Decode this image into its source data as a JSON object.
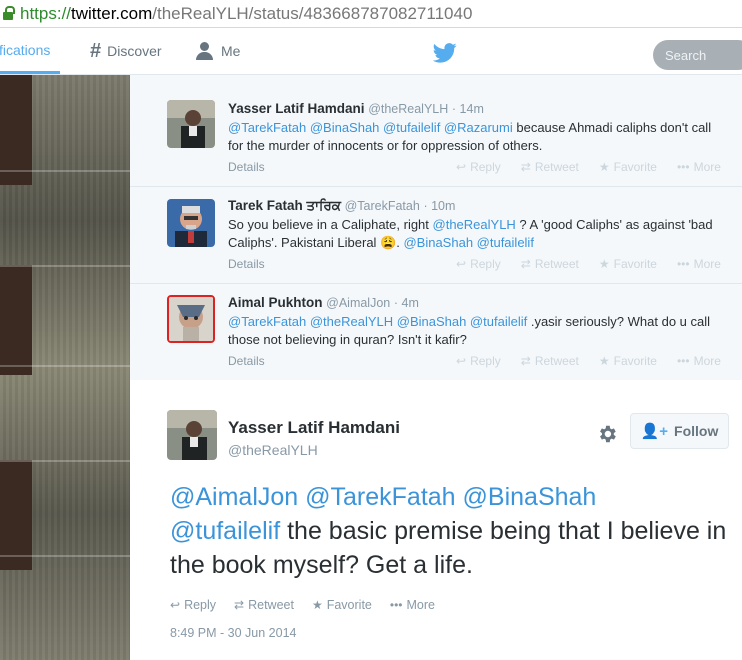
{
  "browser": {
    "url_scheme": "https://",
    "url_host": "twitter.com",
    "url_path": "/theRealYLH/status/483668787082711040"
  },
  "nav": {
    "notifications": "tifications",
    "discover": "Discover",
    "me": "Me",
    "search_placeholder": "Search"
  },
  "replies": [
    {
      "name": "Yasser Latif Hamdani",
      "handle": "@theRealYLH",
      "time": "· 14m",
      "mentions": "@TarekFatah @BinaShah @tufailelif @Razarumi",
      "text": " because Ahmadi caliphs don't call for the murder of innocents or for oppression of others."
    },
    {
      "name": "Tarek Fatah ਤਾਰਿਕ",
      "handle": "@TarekFatah",
      "time": "· 10m",
      "text_a": "So you believe in a Caliphate, right ",
      "mention_a": "@theRealYLH",
      "text_b": " ? A 'good Caliphs' as against 'bad Caliphs'. Pakistani Liberal 😩.   ",
      "mention_b": "@BinaShah @tufailelif"
    },
    {
      "name": "Aimal Pukhton",
      "handle": "@AimalJon",
      "time": "· 4m",
      "mentions": "@TarekFatah @theRealYLH @BinaShah @tufailelif",
      "text": " .yasir seriously?  What do u call those not believing in quran? Isn't it kafir?"
    }
  ],
  "reply_ui": {
    "details": "Details",
    "reply": "Reply",
    "retweet": "Retweet",
    "favorite": "Favorite",
    "more": "More"
  },
  "main_tweet": {
    "name": "Yasser Latif Hamdani",
    "handle": "@theRealYLH",
    "follow_label": "Follow",
    "mentions_line1": "@AimalJon @TarekFatah @BinaShah",
    "mention_line2": "@tufailelif",
    "text": "  the basic premise being that I believe in the book myself?  Get a life.",
    "timestamp": "8:49 PM - 30 Jun 2014"
  },
  "colors": {
    "accent": "#55acee",
    "mention": "#3b94d9",
    "muted": "#8899a6"
  }
}
